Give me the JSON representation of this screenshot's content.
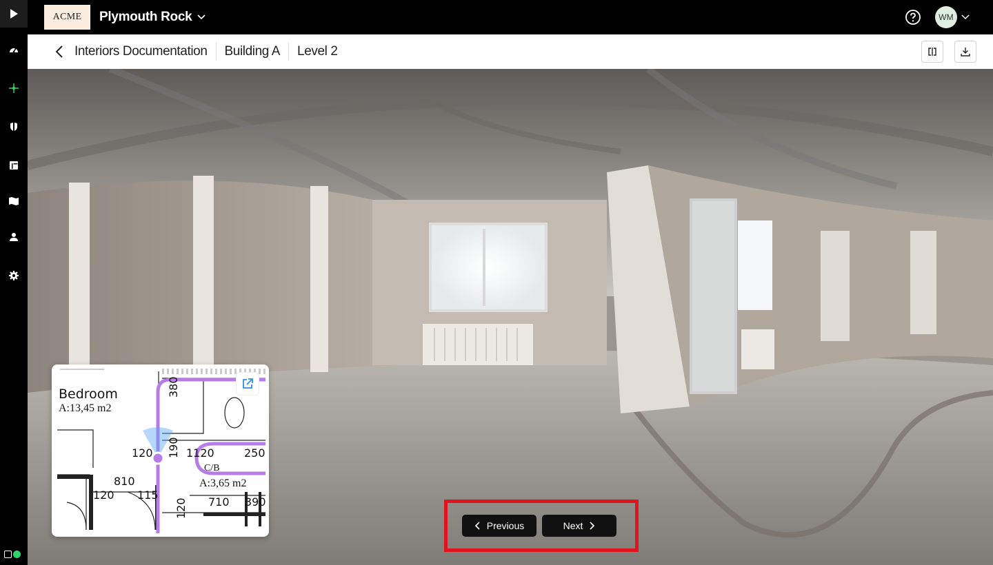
{
  "app": {
    "logo_text": "ACME",
    "project_name": "Plymouth Rock",
    "user_initials": "WM",
    "status_dot_color": "#2fd36a",
    "accent_green": "#2fd36a"
  },
  "sidebar": {
    "items": [
      {
        "name": "dashboard",
        "icon": "gauge-icon"
      },
      {
        "name": "capture",
        "icon": "crosshair-icon",
        "active": true
      },
      {
        "name": "safety",
        "icon": "shield-icon"
      },
      {
        "name": "documents",
        "icon": "layout-icon"
      },
      {
        "name": "map",
        "icon": "map-icon"
      },
      {
        "name": "users",
        "icon": "person-icon"
      },
      {
        "name": "settings",
        "icon": "gear-icon"
      }
    ]
  },
  "breadcrumb": {
    "items": [
      "Interiors Documentation",
      "Building A",
      "Level 2"
    ]
  },
  "minimap": {
    "room_name": "Bedroom",
    "room_area": "A:13,45 m2",
    "dim_380": "380",
    "dim_190": "190",
    "dim_120_left": "120",
    "dim_1120": "1120",
    "dim_250": "250",
    "room2_name": "C/B",
    "room2_area": "A:3,65 m2",
    "dim_810": "810",
    "dim_120_bottom": "120",
    "dim_115": "115",
    "dim_120_vertical": "120",
    "dim_710": "710",
    "dim_390": "390",
    "path_color": "#b77ce8"
  },
  "navigation": {
    "previous_label": "Previous",
    "next_label": "Next",
    "highlight_color": "#e0141e"
  }
}
